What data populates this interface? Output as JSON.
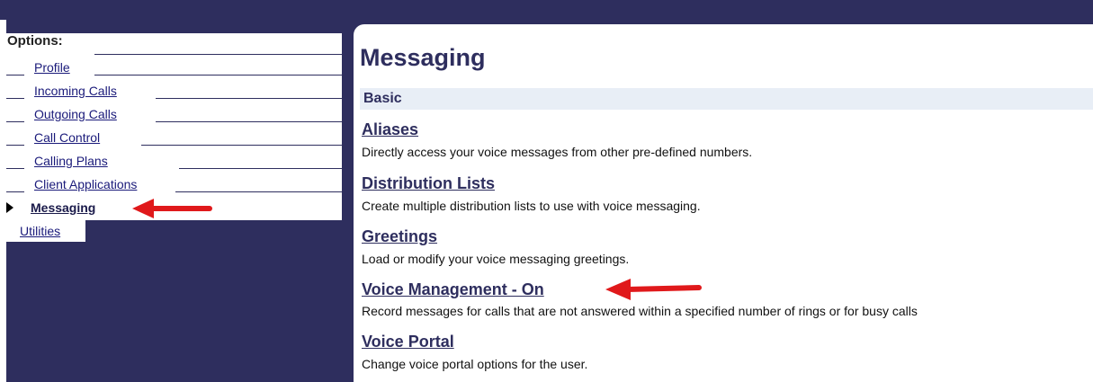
{
  "sidebar": {
    "title": "Options:",
    "items": [
      {
        "label": "Profile"
      },
      {
        "label": "Incoming Calls"
      },
      {
        "label": "Outgoing Calls"
      },
      {
        "label": "Call Control"
      },
      {
        "label": "Calling Plans"
      },
      {
        "label": "Client Applications"
      },
      {
        "label": "Messaging"
      },
      {
        "label": "Utilities"
      }
    ],
    "selected": "Messaging"
  },
  "main": {
    "title": "Messaging",
    "section": "Basic",
    "items": [
      {
        "label": "Aliases",
        "description": "Directly access your voice messages from other pre-defined numbers."
      },
      {
        "label": "Distribution Lists",
        "description": "Create multiple distribution lists to use with voice messaging."
      },
      {
        "label": "Greetings",
        "description": "Load or modify your voice messaging greetings."
      },
      {
        "label": "Voice Management - On",
        "description": "Record messages for calls that are not answered within a specified number of rings or for busy calls"
      },
      {
        "label": "Voice Portal",
        "description": "Change voice portal options for the user."
      }
    ]
  },
  "colors": {
    "header": "#2e2e5e",
    "section_bar": "#e8eef6",
    "annotation_arrow": "#e0191b"
  }
}
